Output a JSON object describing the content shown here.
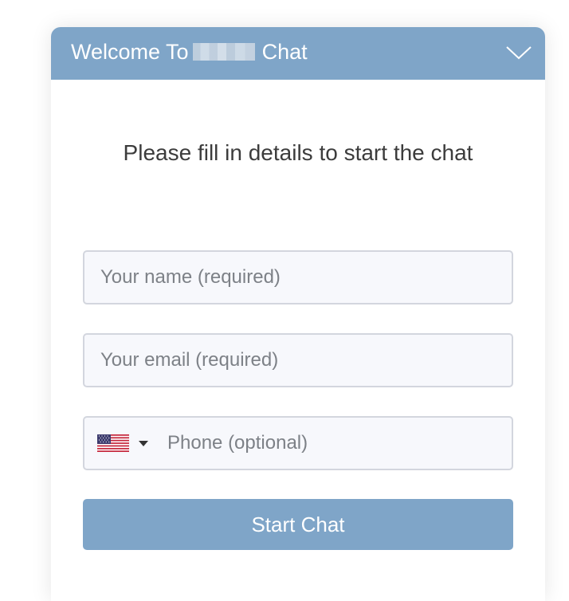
{
  "header": {
    "title_prefix": "Welcome To",
    "title_suffix": "Chat",
    "bg_color": "#7fa5c8",
    "collapse_icon": "chevron-down-icon"
  },
  "intro_text": "Please fill in details to start the chat",
  "form": {
    "name_placeholder": "Your name (required)",
    "email_placeholder": "Your email (required)",
    "phone_placeholder": "Phone (optional)",
    "country_flag": "us-flag-icon",
    "submit_label": "Start Chat",
    "submit_color": "#7fa5c8"
  }
}
